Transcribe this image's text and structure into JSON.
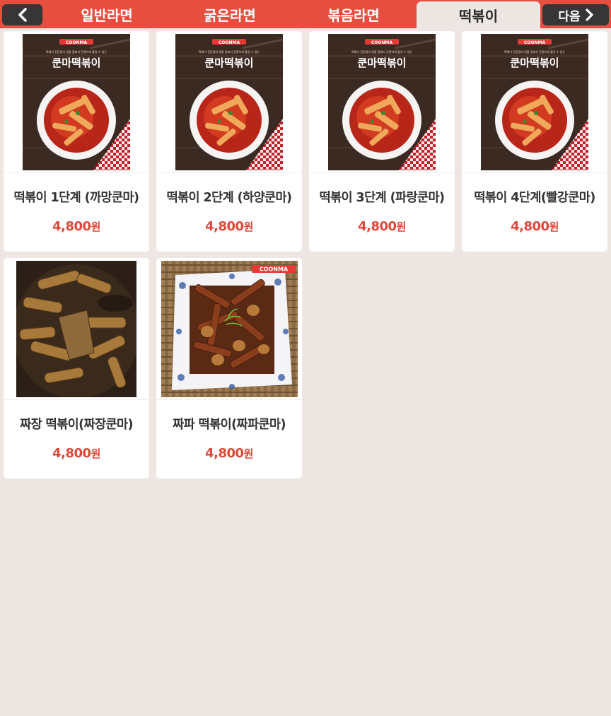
{
  "header": {
    "tabs": [
      {
        "label": "일반라면"
      },
      {
        "label": "굵은라면"
      },
      {
        "label": "볶음라면"
      },
      {
        "label": "떡볶이"
      }
    ],
    "active_tab": "떡볶이",
    "next_label": "다음",
    "accent_color": "#e64e3f"
  },
  "products": [
    {
      "name": "떡볶이 1단계 (까망쿤마)",
      "price": "4,800",
      "unit": "원",
      "brand": "COONMA",
      "package_title": "쿤마떡볶이",
      "package_tagline": "떡볶이 전문점의 맛을 집에서 간편하게 즐길 수 있는"
    },
    {
      "name": "떡볶이 2단계 (하양쿤마)",
      "price": "4,800",
      "unit": "원",
      "brand": "COONMA",
      "package_title": "쿤마떡볶이",
      "package_tagline": "떡볶이 전문점의 맛을 집에서 간편하게 즐길 수 있는"
    },
    {
      "name": "떡볶이 3단계 (파랑쿤마)",
      "price": "4,800",
      "unit": "원",
      "brand": "COONMA",
      "package_title": "쿤마떡볶이",
      "package_tagline": "떡볶이 전문점의 맛을 집에서 간편하게 즐길 수 있는"
    },
    {
      "name": "떡볶이 4단계(빨강쿤마)",
      "price": "4,800",
      "unit": "원",
      "brand": "COONMA",
      "package_title": "쿤마떡볶이",
      "package_tagline": "떡볶이 전문점의 맛을 집에서 간편하게 즐길 수 있는"
    },
    {
      "name": "짜장 떡볶이(짜장쿤마)",
      "price": "4,800",
      "unit": "원"
    },
    {
      "name": "짜파 떡볶이(짜파쿤마)",
      "price": "4,800",
      "unit": "원",
      "brand": "COONMA"
    }
  ],
  "icons": {
    "prev": "chevron-left-icon",
    "next": "chevron-right-icon"
  }
}
